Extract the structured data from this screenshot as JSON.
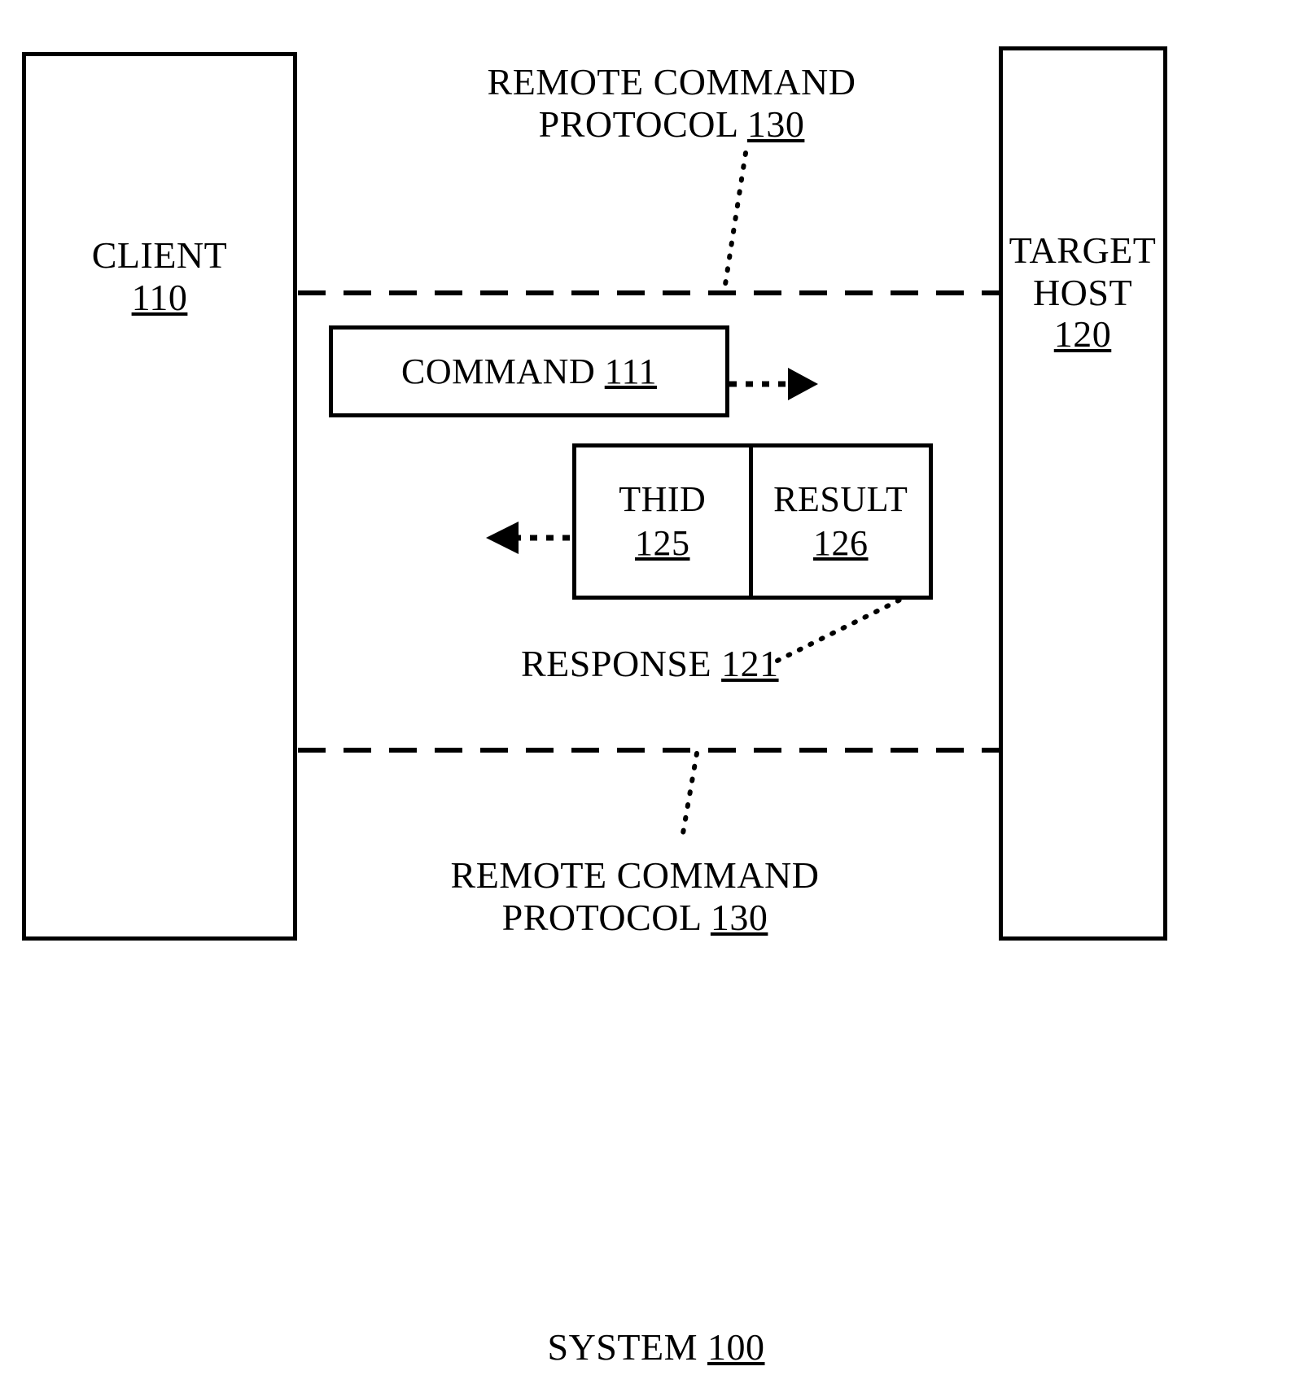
{
  "figure": {
    "caption_text": "SYSTEM",
    "caption_ref": "100"
  },
  "client": {
    "line1": "CLIENT",
    "ref": "110"
  },
  "target_host": {
    "line1": "TARGET",
    "line2": "HOST",
    "ref": "120"
  },
  "protocol_top": {
    "line1": "REMOTE COMMAND",
    "line2_text": "PROTOCOL",
    "line2_ref": "130"
  },
  "protocol_bottom": {
    "line1": "REMOTE COMMAND",
    "line2_text": "PROTOCOL",
    "line2_ref": "130"
  },
  "command_box": {
    "text": "COMMAND",
    "ref": "111"
  },
  "response": {
    "label_text": "RESPONSE",
    "label_ref": "121",
    "thid": {
      "text": "THID",
      "ref": "125"
    },
    "result": {
      "text": "RESULT",
      "ref": "126"
    }
  },
  "colors": {
    "ink": "#000000",
    "paper": "#ffffff"
  }
}
